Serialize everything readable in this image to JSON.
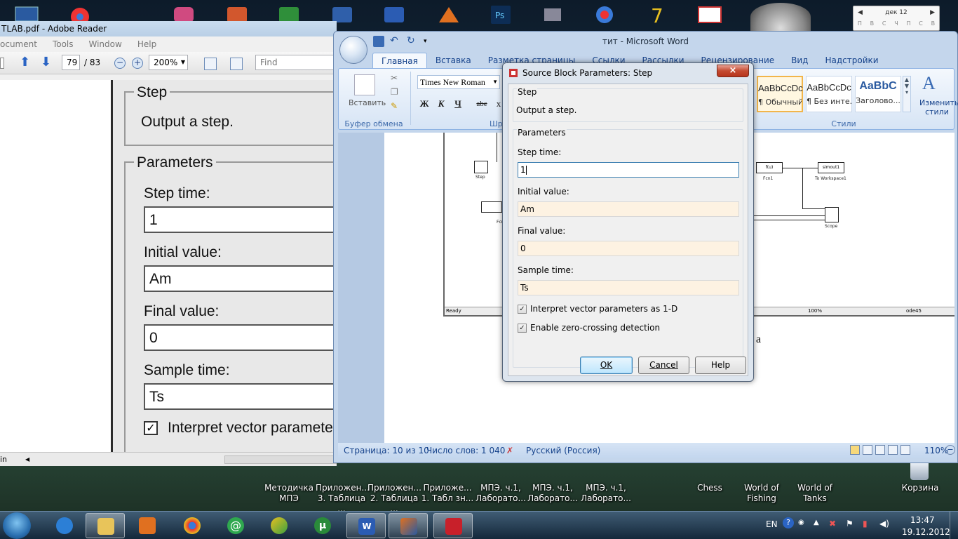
{
  "desktop": {
    "calendar": {
      "month": "дек 12",
      "days": [
        "П",
        "В",
        "С",
        "Ч",
        "П",
        "С",
        "В"
      ]
    },
    "shortcuts": [
      {
        "line1": "Методичка",
        "line2": "МПЭ"
      },
      {
        "line1": "Приложен...",
        "line2": "3. Таблица ..."
      },
      {
        "line1": "Приложен...",
        "line2": "2. Таблица ..."
      },
      {
        "line1": "Приложе...",
        "line2": "1. Табл зн..."
      },
      {
        "line1": "МПЭ. ч.1,",
        "line2": "Лаборато..."
      },
      {
        "line1": "МПЭ. ч.1,",
        "line2": "Лаборато..."
      },
      {
        "line1": "МПЭ. ч.1,",
        "line2": "Лаборато..."
      },
      {
        "line1": "Chess",
        "line2": ""
      },
      {
        "line1": "World of",
        "line2": "Fishing"
      },
      {
        "line1": "World of",
        "line2": "Tanks"
      },
      {
        "line1": "Корзина",
        "line2": ""
      }
    ]
  },
  "reader": {
    "title": "TLAB.pdf - Adobe Reader",
    "menu": [
      "ocument",
      "Tools",
      "Window",
      "Help"
    ],
    "page_current": "79",
    "page_total": "/ 83",
    "zoom": "200%",
    "find_placeholder": "Find",
    "status_left": "in",
    "page_content": {
      "step_heading": "Step",
      "step_desc": "Output a step.",
      "params_heading": "Parameters",
      "step_time_label": "Step time:",
      "step_time_value": "1",
      "initial_label": "Initial value:",
      "initial_value": "Am",
      "final_label": "Final value:",
      "final_value": "0",
      "sample_label": "Sample time:",
      "sample_value": "Ts",
      "interpret_label": "Interpret vector paramete"
    }
  },
  "word": {
    "title": "тит - Microsoft Word",
    "tabs": [
      "Главная",
      "Вставка",
      "Разметка страницы",
      "Ссылки",
      "Рассылки",
      "Рецензирование",
      "Вид",
      "Надстройки"
    ],
    "paste_label": "Вставить",
    "clipboard_group": "Буфер обмена",
    "font_group": "Шри",
    "styles_group": "Стили",
    "font_name": "Times New Roman",
    "fmt": {
      "bold": "Ж",
      "italic": "К",
      "underline": "Ч",
      "strike": "abe",
      "clear": "x"
    },
    "styles": [
      {
        "preview": "AaBbCcDc",
        "name": "¶ Обычный"
      },
      {
        "preview": "AaBbCcDc",
        "name": "¶ Без инте..."
      },
      {
        "preview": "AaBbC",
        "name": "Заголово..."
      }
    ],
    "change_styles": "Изменить стили",
    "doc_fragment": "а",
    "simulink": {
      "status_ready": "Ready",
      "status_zoom": "100%",
      "status_solver": "ode45",
      "blocks": {
        "step": "Step",
        "fcn_text": "f(u)",
        "fcn": "Fcn1",
        "fcn2": "Fcn",
        "simout": "simout1",
        "workspace": "To Workspace1",
        "scope": "Scope"
      }
    },
    "status": {
      "page": "Страница: 10 из 10",
      "words": "Число слов: 1 040",
      "lang": "Русский (Россия)",
      "zoom": "110%"
    }
  },
  "dialog": {
    "title": "Source Block Parameters: Step",
    "block_name": "Step",
    "description": "Output a step.",
    "params_heading": "Parameters",
    "fields": [
      {
        "label": "Step time:",
        "value": "1"
      },
      {
        "label": "Initial value:",
        "value": "Am"
      },
      {
        "label": "Final value:",
        "value": "0"
      },
      {
        "label": "Sample time:",
        "value": "Ts"
      }
    ],
    "checkboxes": [
      {
        "label": "Interpret vector parameters as 1-D",
        "checked": true
      },
      {
        "label": "Enable zero-crossing detection",
        "checked": true
      }
    ],
    "buttons": {
      "ok": "OK",
      "cancel": "Cancel",
      "help": "Help"
    },
    "close_symbol": "×"
  },
  "taskbar": {
    "lang": "EN",
    "time": "13:47",
    "date": "19.12.2012"
  },
  "colors": {
    "ribbon_blue": "#15428b",
    "input_tint": "#fdf2e2",
    "close_red": "#c44a30"
  }
}
